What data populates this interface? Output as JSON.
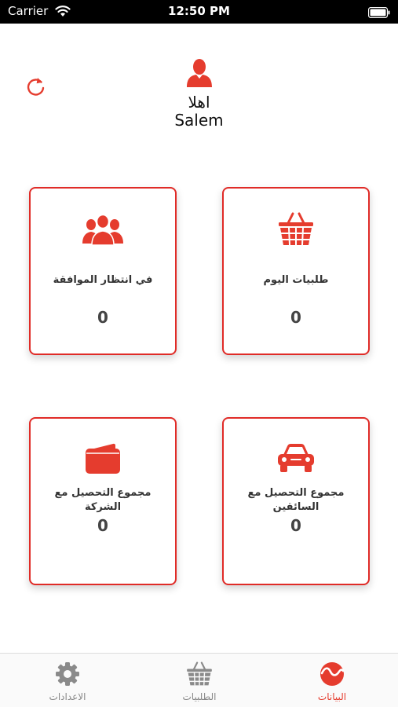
{
  "status_bar": {
    "carrier": "Carrier",
    "time": "12:50 PM"
  },
  "colors": {
    "accent": "#e53c2e",
    "border": "#e02b27",
    "tab_inactive": "#888888"
  },
  "profile": {
    "greeting": "اهلا",
    "name": "Salem"
  },
  "cards": {
    "today_orders": {
      "label": "طلبيات اليوم",
      "value": "0",
      "icon": "basket-icon"
    },
    "pending_approval": {
      "label": "في انتظار الموافقة",
      "value": "0",
      "icon": "users-group-icon"
    },
    "drivers_collection": {
      "label": "مجموع التحصيل مع السائقين",
      "value": "0",
      "icon": "car-icon"
    },
    "company_collection": {
      "label": "مجموع التحصيل مع الشركة",
      "value": "0",
      "icon": "wallet-icon"
    }
  },
  "tabs": {
    "settings": {
      "label": "الاعدادات",
      "icon": "gear-icon"
    },
    "orders": {
      "label": "الطلبيات",
      "icon": "basket-icon"
    },
    "data": {
      "label": "البيانات",
      "icon": "wave-circle-icon",
      "active": true
    }
  }
}
